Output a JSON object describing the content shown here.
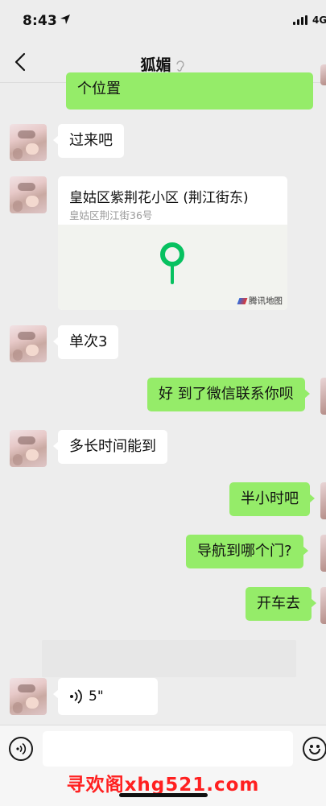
{
  "status_bar": {
    "time": "8:43",
    "network": "4G"
  },
  "header": {
    "title": "狐媚"
  },
  "messages": {
    "m0": "个位置",
    "m1": "过来吧",
    "location": {
      "name": "皇姑区紫荆花小区 (荆江街东)",
      "address": "皇姑区荆江街36号",
      "map_provider": "腾讯地图"
    },
    "m2": "单次3",
    "m3": "好 到了微信联系你呗",
    "m4": "多长时间能到",
    "m5": "半小时吧",
    "m6": "导航到哪个门?",
    "m7": "开车去",
    "voice": {
      "duration": "5\""
    }
  },
  "watermark": "寻欢阁xhg521.com",
  "colors": {
    "sent_bubble": "#95ec69",
    "received_bubble": "#ffffff",
    "background": "#ededed",
    "pin": "#07c160"
  }
}
